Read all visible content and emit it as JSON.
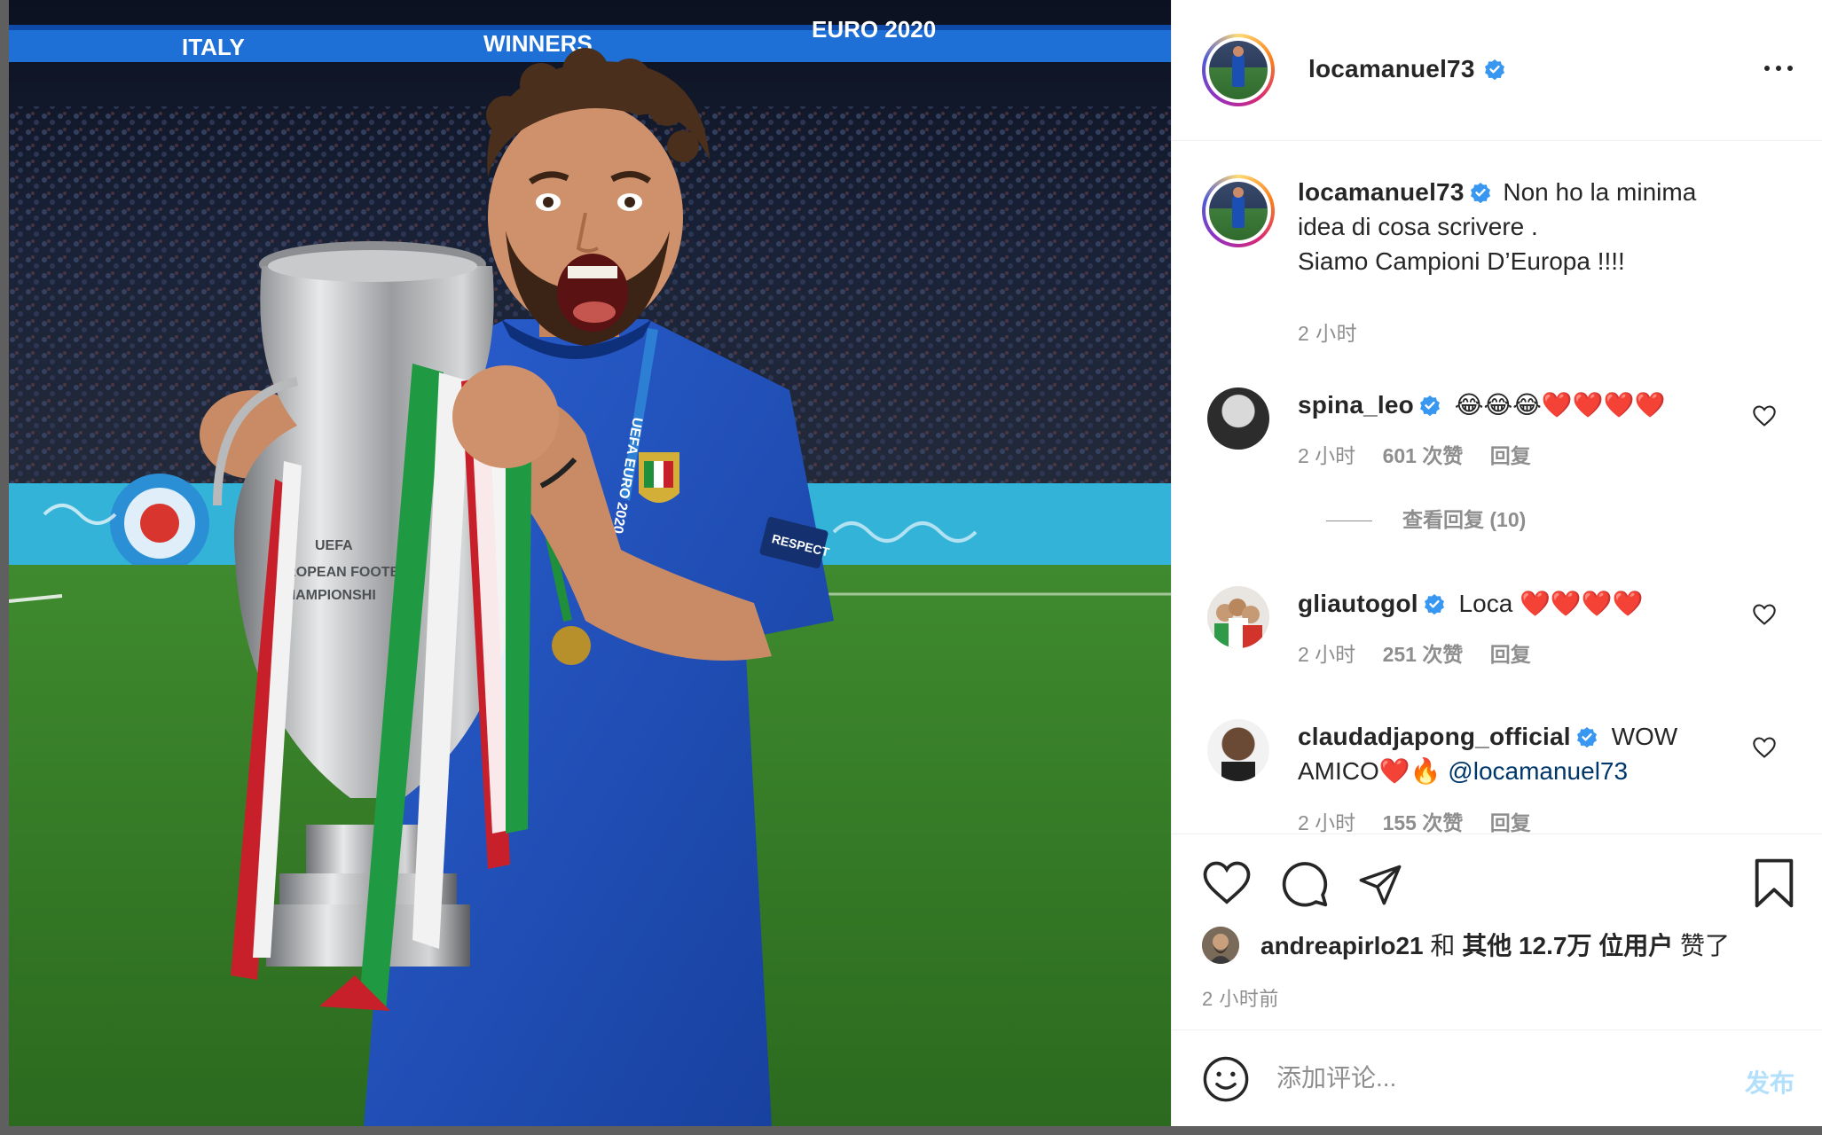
{
  "photo": {
    "banner_words": [
      "ITALY",
      "WINNERS",
      "EURO 2020"
    ],
    "lanyard_text": "UEFA EURO 2020",
    "sleeve_badge": "RESPECT",
    "trophy_engraving": [
      "UEFA",
      "EUROPEAN FOOTB",
      "CHAMPIONSHI"
    ]
  },
  "header": {
    "username": "locamanuel73",
    "verified_icon": "verified-badge-icon",
    "more_icon": "more-options-icon"
  },
  "caption": {
    "username": "locamanuel73",
    "text": "Non ho la minima\nidea di cosa scrivere .\nSiamo Campioni D’Europa !!!!",
    "time": "2 小时"
  },
  "comments": [
    {
      "username": "spina_leo",
      "text": "😂😂😂❤️❤️❤️❤️",
      "time": "2 小时",
      "likes": "601 次赞",
      "reply": "回复",
      "view_replies": "查看回复 (10)"
    },
    {
      "username": "gliautogol",
      "text": "Loca ❤️❤️❤️❤️",
      "time": "2 小时",
      "likes": "251 次赞",
      "reply": "回复"
    },
    {
      "username": "claudadjapong_official",
      "text_prefix": "WOW AMICO❤️🔥",
      "mention": "@locamanuel73",
      "time": "2 小时",
      "likes": "155 次赞",
      "reply": "回复"
    }
  ],
  "actions": {
    "like_icon": "heart-icon",
    "comment_icon": "comment-icon",
    "share_icon": "send-icon",
    "save_icon": "bookmark-icon"
  },
  "likes": {
    "user": "andreapirlo21",
    "and": " 和 ",
    "others": "其他 12.7万 位用户",
    "suffix": " 赞了"
  },
  "posted_time": "2 小时前",
  "comment_box": {
    "emoji_icon": "emoji-icon",
    "placeholder": "添加评论...",
    "post_label": "发布"
  },
  "colors": {
    "verified_blue": "#3897f0",
    "link_blue": "#00376b",
    "post_disabled": "#b2dffc",
    "secondary_text": "#8e8e8e"
  }
}
